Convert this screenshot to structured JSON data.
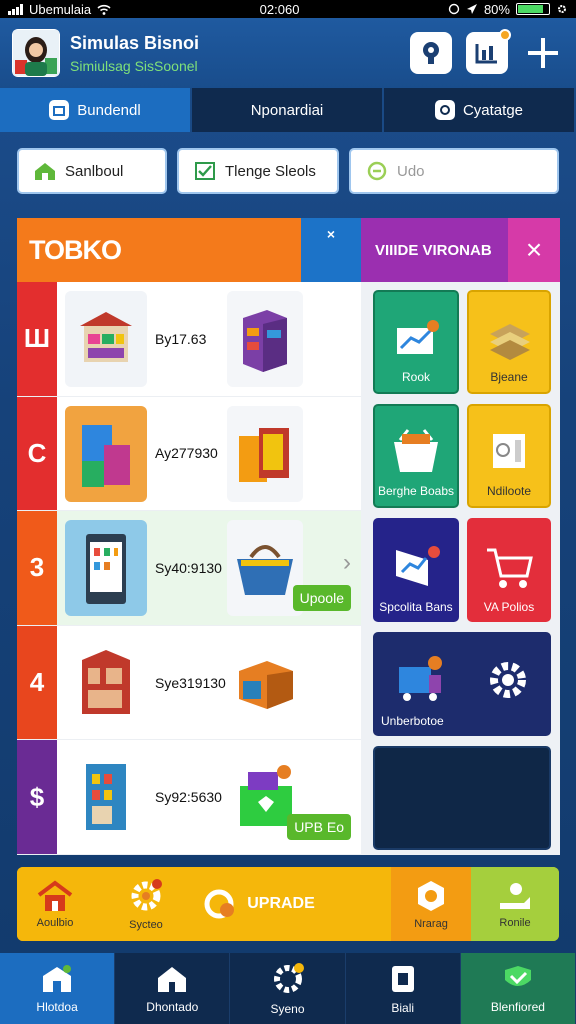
{
  "status_bar": {
    "carrier": "Ubemulaia",
    "time": "02:060",
    "battery": "80%"
  },
  "header": {
    "title": "Simulas Bisnoi",
    "subtitle": "Simiulsag SisSoonel"
  },
  "tabs": [
    {
      "label": "Bundendl"
    },
    {
      "label": "Nponardiai"
    },
    {
      "label": "Cyatatge"
    }
  ],
  "filters": [
    {
      "label": "Sanlboul"
    },
    {
      "label": "Tlenge Sleols"
    },
    {
      "label": "Udo"
    }
  ],
  "store": {
    "title": "TOBKO",
    "close_label": "×",
    "rows": [
      {
        "num": "Ш",
        "price": "By17.63",
        "color": "#e32e2e"
      },
      {
        "num": "C",
        "price": "Ay277930",
        "color": "#e32e2e"
      },
      {
        "num": "3",
        "price": "Sy40:9130",
        "color": "#f05a1a",
        "chevron": "›",
        "upgrade": "Upoole"
      },
      {
        "num": "4",
        "price": "Sye319130",
        "color": "#e8461e"
      },
      {
        "num": "$",
        "price": "Sy92:5630",
        "color": "#6a2b94",
        "upgrade": "UPB Eo"
      }
    ]
  },
  "side": {
    "title": "VIIIDE VIRONAB",
    "close_label": "×",
    "tiles": [
      {
        "label": "Rook"
      },
      {
        "label": "Bjeane"
      },
      {
        "label": "Berghe Boabs"
      },
      {
        "label": "Ndiloote"
      },
      {
        "label": "Spcolita Bans"
      },
      {
        "label": "VA Polios"
      },
      {
        "label": "Unberbotoe"
      },
      {
        "label": ""
      }
    ]
  },
  "actions": [
    {
      "label": "Aoulbio"
    },
    {
      "label": "Sycteo"
    },
    {
      "label": "UPRADE"
    },
    {
      "label": "Nrarag"
    },
    {
      "label": "Ronile"
    }
  ],
  "nav": [
    {
      "label": "Hlotdoa"
    },
    {
      "label": "Dhontado"
    },
    {
      "label": "Syeno"
    },
    {
      "label": "Biali"
    },
    {
      "label": "Blenfiored"
    }
  ]
}
